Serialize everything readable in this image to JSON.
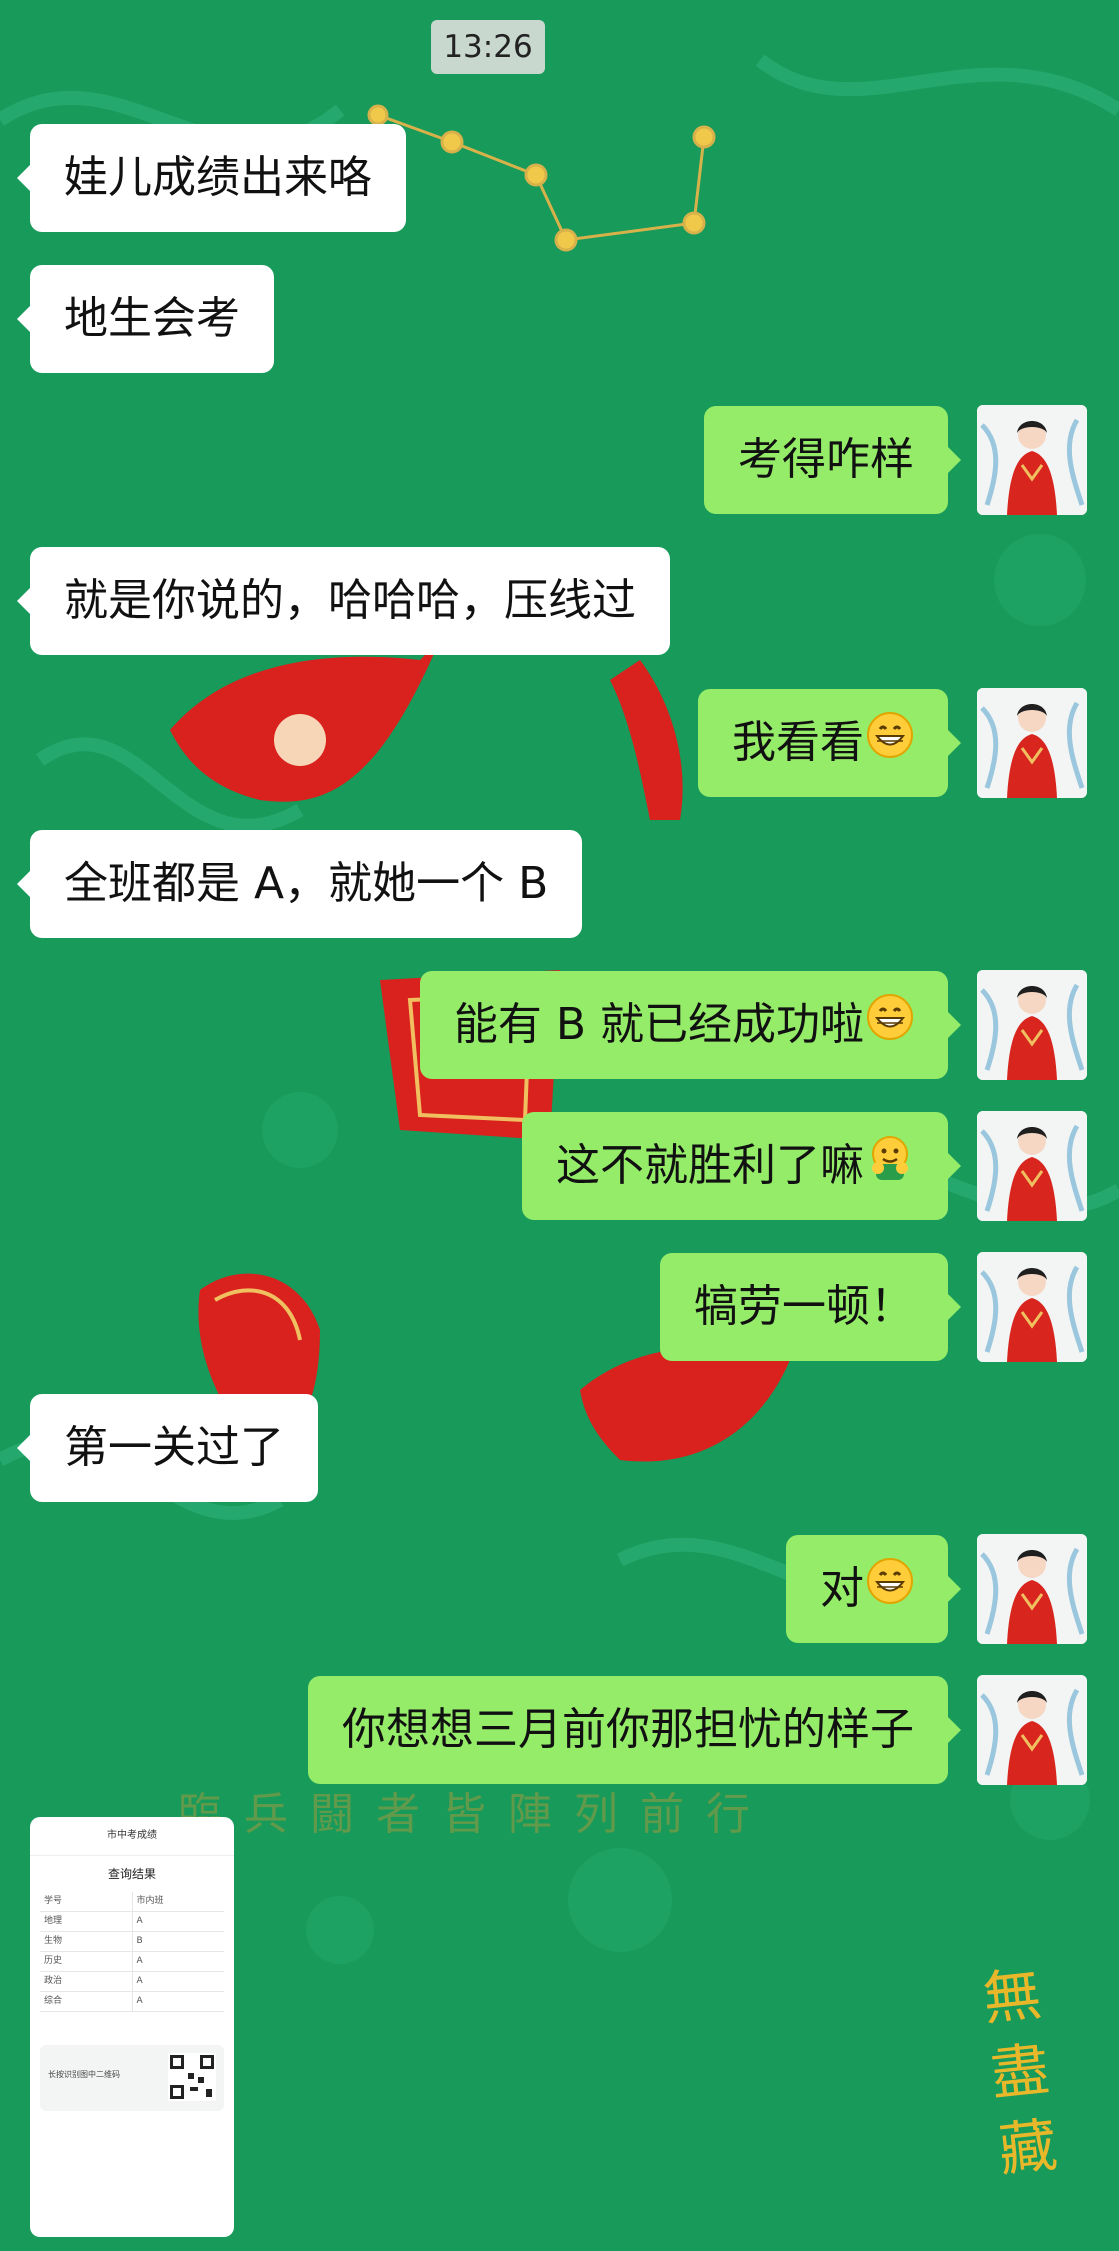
{
  "status_time": "13:26",
  "messages": [
    {
      "side": "in",
      "text": "娃儿成绩出来咯"
    },
    {
      "side": "in",
      "text": "地生会考"
    },
    {
      "side": "out",
      "text": "考得咋样"
    },
    {
      "side": "in",
      "text": "就是你说的，哈哈哈，压线过"
    },
    {
      "side": "out",
      "text": "我看看",
      "emoji": "grinning-face"
    },
    {
      "side": "in",
      "text": "全班都是 A，就她一个 B"
    },
    {
      "side": "out",
      "text": "能有 B 就已经成功啦",
      "emoji": "grinning-face"
    },
    {
      "side": "out",
      "text": "这不就胜利了嘛",
      "emoji": "hugging-face"
    },
    {
      "side": "out",
      "text": "犒劳一顿！"
    },
    {
      "side": "in",
      "text": "第一关过了"
    },
    {
      "side": "out",
      "text": "对",
      "emoji": "grinning-face"
    },
    {
      "side": "out",
      "text": "你想想三月前你那担忧的样子"
    }
  ],
  "background": {
    "slogan": "臨兵闘者皆陣列前行",
    "seal": "無盡藏"
  },
  "screenshot_thumbnail": {
    "header": "市中考成绩",
    "title": "查询结果",
    "rows": [
      [
        "学号",
        "市内班"
      ],
      [
        "地理",
        "A"
      ],
      [
        "生物",
        "B"
      ],
      [
        "历史",
        "A"
      ],
      [
        "政治",
        "A"
      ],
      [
        "综合",
        "A"
      ]
    ],
    "footer_text": "长按识别图中二维码"
  },
  "colors": {
    "background": "#179a5a",
    "incoming_bubble": "#ffffff",
    "outgoing_bubble": "#95ec69",
    "time_pill": "#c8d8cf"
  }
}
